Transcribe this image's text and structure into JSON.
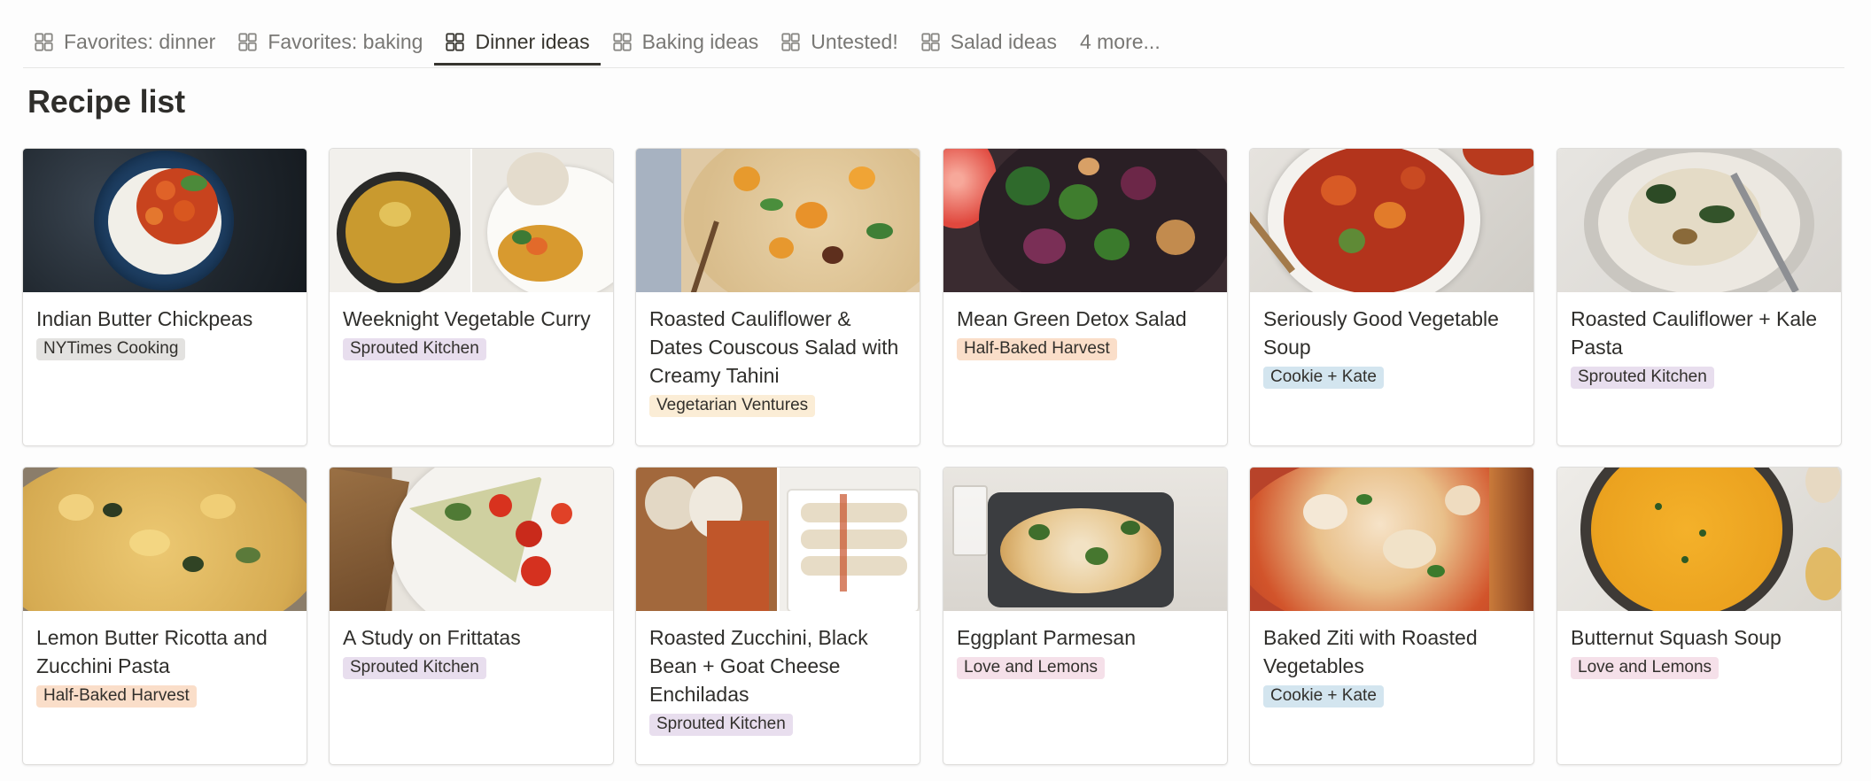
{
  "tabs": [
    {
      "label": "Favorites: dinner",
      "icon": "gallery-icon",
      "active": false
    },
    {
      "label": "Favorites: baking",
      "icon": "gallery-icon",
      "active": false
    },
    {
      "label": "Dinner ideas",
      "icon": "gallery-icon",
      "active": true
    },
    {
      "label": "Baking ideas",
      "icon": "gallery-icon",
      "active": false
    },
    {
      "label": "Untested!",
      "icon": "gallery-icon",
      "active": false
    },
    {
      "label": "Salad ideas",
      "icon": "gallery-icon",
      "active": false
    }
  ],
  "more_tabs_label": "4 more...",
  "page_title": "Recipe list",
  "tag_colors": {
    "gray": "#e3e2e0",
    "purple": "#e8deee",
    "orange": "#fadec9",
    "yellow": "#fbedd6",
    "blue": "#d3e5ef",
    "pink": "#f5e0e9"
  },
  "cards": [
    {
      "title": "Indian Butter Chickpeas",
      "source": "NYTimes Cooking",
      "tag_color": "gray",
      "cover": "chickpea-curry-bowl-photo"
    },
    {
      "title": "Weeknight Vegetable Curry",
      "source": "Sprouted Kitchen",
      "tag_color": "purple",
      "cover": "vegetable-curry-photo"
    },
    {
      "title": "Roasted Cauliflower & Dates Couscous Salad with Creamy Tahini",
      "source": "Vegetarian Ventures",
      "tag_color": "yellow",
      "cover": "couscous-salad-photo"
    },
    {
      "title": "Mean Green Detox Salad",
      "source": "Half-Baked Harvest",
      "tag_color": "orange",
      "cover": "detox-salad-photo"
    },
    {
      "title": "Seriously Good Vegetable Soup",
      "source": "Cookie + Kate",
      "tag_color": "blue",
      "cover": "vegetable-soup-photo"
    },
    {
      "title": "Roasted Cauliflower + Kale Pasta",
      "source": "Sprouted Kitchen",
      "tag_color": "purple",
      "cover": "kale-pasta-photo"
    },
    {
      "title": "Lemon Butter Ricotta and Zucchini Pasta",
      "source": "Half-Baked Harvest",
      "tag_color": "orange",
      "cover": "ricotta-pasta-photo"
    },
    {
      "title": "A Study on Frittatas",
      "source": "Sprouted Kitchen",
      "tag_color": "purple",
      "cover": "frittata-photo"
    },
    {
      "title": "Roasted Zucchini, Black Bean + Goat Cheese Enchiladas",
      "source": "Sprouted Kitchen",
      "tag_color": "purple",
      "cover": "enchiladas-photo"
    },
    {
      "title": "Eggplant Parmesan",
      "source": "Love and Lemons",
      "tag_color": "pink",
      "cover": "eggplant-parmesan-photo"
    },
    {
      "title": "Baked Ziti with Roasted Vegetables",
      "source": "Cookie + Kate",
      "tag_color": "blue",
      "cover": "baked-ziti-photo"
    },
    {
      "title": "Butternut Squash Soup",
      "source": "Love and Lemons",
      "tag_color": "pink",
      "cover": "squash-soup-photo"
    }
  ]
}
